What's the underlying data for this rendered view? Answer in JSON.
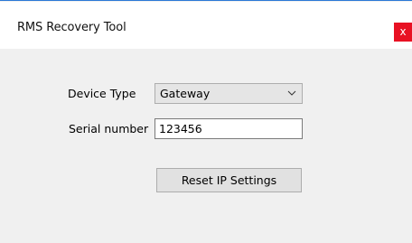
{
  "window": {
    "title": "RMS Recovery Tool",
    "close_glyph": "x",
    "close_color": "#e81123",
    "accent_color": "#2b79d6"
  },
  "form": {
    "device_type_label": "Device Type",
    "device_type_value": "Gateway",
    "serial_label": "Serial number",
    "serial_value": "123456",
    "reset_button_label": "Reset IP Settings"
  },
  "icons": {
    "dropdown": "chevron-down-icon",
    "close": "close-icon"
  }
}
